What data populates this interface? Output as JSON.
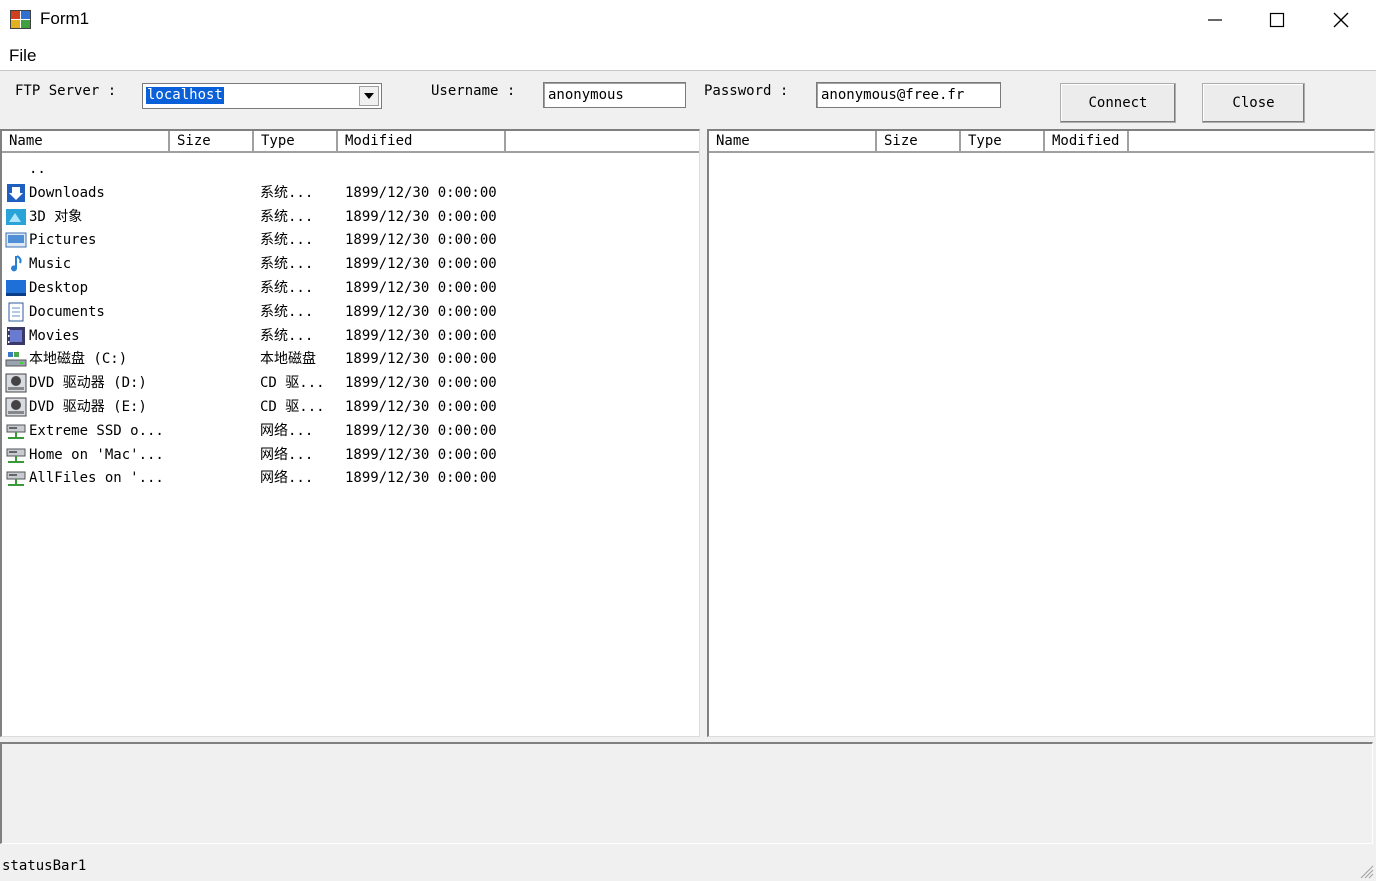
{
  "window": {
    "title": "Form1"
  },
  "menu": {
    "file": "File"
  },
  "toolbar": {
    "server_label": "FTP Server :",
    "server_value": "localhost",
    "username_label": "Username :",
    "username_value": "anonymous",
    "password_label": "Password :",
    "password_value": "anonymous@free.fr",
    "connect_label": "Connect",
    "close_label": "Close"
  },
  "local": {
    "columns": [
      "Name",
      "Size",
      "Type",
      "Modified"
    ],
    "rows": [
      {
        "icon": "parent-dir-icon",
        "name": "..",
        "type": "",
        "modified": ""
      },
      {
        "icon": "downloads-icon",
        "name": "Downloads",
        "type": "系统...",
        "modified": "1899/12/30 0:00:00"
      },
      {
        "icon": "3d-objects-icon",
        "name": "3D 对象",
        "type": "系统...",
        "modified": "1899/12/30 0:00:00"
      },
      {
        "icon": "pictures-icon",
        "name": "Pictures",
        "type": "系统...",
        "modified": "1899/12/30 0:00:00"
      },
      {
        "icon": "music-icon",
        "name": "Music",
        "type": "系统...",
        "modified": "1899/12/30 0:00:00"
      },
      {
        "icon": "desktop-icon",
        "name": "Desktop",
        "type": "系统...",
        "modified": "1899/12/30 0:00:00"
      },
      {
        "icon": "documents-icon",
        "name": "Documents",
        "type": "系统...",
        "modified": "1899/12/30 0:00:00"
      },
      {
        "icon": "movies-icon",
        "name": "Movies",
        "type": "系统...",
        "modified": "1899/12/30 0:00:00"
      },
      {
        "icon": "local-disk-icon",
        "name": "本地磁盘 (C:)",
        "type": "本地磁盘",
        "modified": "1899/12/30 0:00:00"
      },
      {
        "icon": "dvd-drive-icon",
        "name": "DVD 驱动器 (D:)",
        "type": "CD 驱...",
        "modified": "1899/12/30 0:00:00"
      },
      {
        "icon": "dvd-drive-icon",
        "name": "DVD 驱动器 (E:)",
        "type": "CD 驱...",
        "modified": "1899/12/30 0:00:00"
      },
      {
        "icon": "network-drive-icon",
        "name": "Extreme SSD o...",
        "type": "网络...",
        "modified": "1899/12/30 0:00:00"
      },
      {
        "icon": "network-drive-icon",
        "name": "Home on 'Mac'...",
        "type": "网络...",
        "modified": "1899/12/30 0:00:00"
      },
      {
        "icon": "network-drive-icon",
        "name": "AllFiles on '...",
        "type": "网络...",
        "modified": "1899/12/30 0:00:00"
      }
    ]
  },
  "remote": {
    "columns": [
      "Name",
      "Size",
      "Type",
      "Modified"
    ]
  },
  "status": {
    "text": "statusBar1"
  }
}
